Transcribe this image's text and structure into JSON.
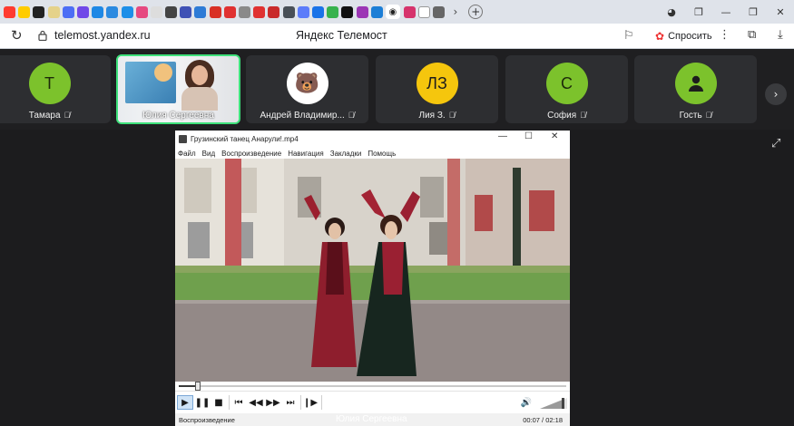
{
  "browser": {
    "tab_favicons": [
      "#ff3b30",
      "#ffcc00",
      "#222222",
      "#e5d28a",
      "#4c6ef5",
      "#7048e8",
      "#1e88e5",
      "#2b8ae0",
      "#1d8fe8",
      "#e64980",
      "#dddddd",
      "#444444",
      "#3f51b5",
      "#2e7bd6",
      "#d93025",
      "#e03131",
      "#8a8a8a",
      "#e03131",
      "#c92a2a",
      "#495057",
      "#5c7cfa",
      "#1a73e8",
      "#37b24d",
      "#111111",
      "#9c36b5",
      "#1c7ed6"
    ],
    "active_tab_icon": "telemost-icon",
    "new_tab_label": "+",
    "url": "telemost.yandex.ru",
    "page_title": "Яндекс Телемост",
    "ask_label": "Спросить"
  },
  "participants": [
    {
      "name": "Тамара",
      "initials": "Т",
      "color": "#7cc22c",
      "type": "initials"
    },
    {
      "name": "Юлия Сергеевна",
      "type": "video"
    },
    {
      "name": "Андрей Владимир...",
      "avatar_icon": "bear-icon",
      "color": "#ffffff",
      "type": "emoji"
    },
    {
      "name": "Лия З.",
      "initials": "ЛЗ",
      "color": "#f5c60d",
      "type": "initials"
    },
    {
      "name": "София",
      "initials": "С",
      "color": "#7cc22c",
      "type": "initials"
    },
    {
      "name": "Гость",
      "avatar_icon": "person-icon",
      "color": "#7cc22c",
      "type": "icon"
    }
  ],
  "player": {
    "window_title": "Грузинский танец Анарули!.mp4",
    "menu": [
      "Файл",
      "Вид",
      "Воспроизведение",
      "Навигация",
      "Закладки",
      "Помощь"
    ],
    "status_text": "Воспроизведение",
    "time_display": "00:07 / 02:18",
    "progress_fraction": 0.05,
    "volume_fraction": 0.85
  },
  "presenter_caption": "Юлия Сергеевна"
}
